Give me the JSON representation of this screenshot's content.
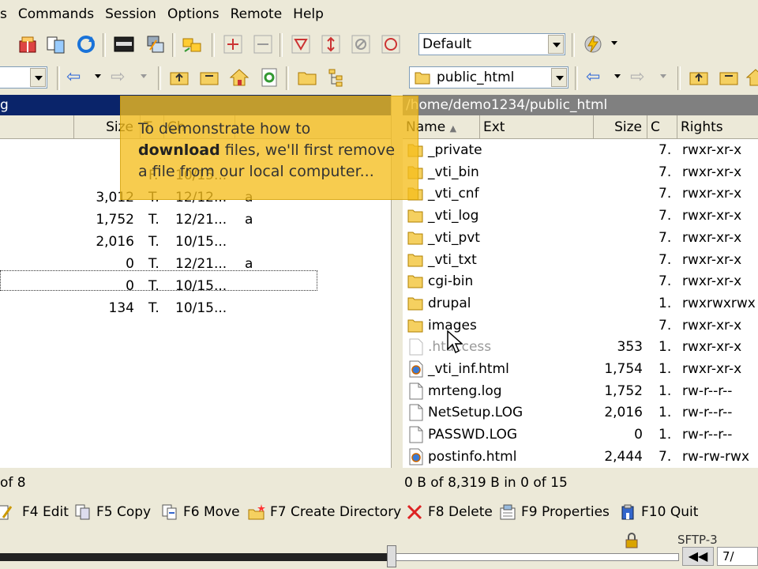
{
  "menu": [
    "s",
    "Commands",
    "Session",
    "Options",
    "Remote",
    "Help"
  ],
  "toolbar": {
    "transfer_settings": "Default"
  },
  "left": {
    "path_combo": "",
    "path": "g",
    "headers": {
      "size": "Size",
      "type": "T.",
      "changed": "Ch"
    },
    "rows": [
      {
        "size": "",
        "type": "F.",
        "changed": "10/15..."
      },
      {
        "size": "3,012",
        "type": "T.",
        "changed": "12/12...",
        "attr": "a"
      },
      {
        "size": "1,752",
        "type": "T.",
        "changed": "12/21...",
        "attr": "a"
      },
      {
        "size": "2,016",
        "type": "T.",
        "changed": "10/15...",
        "attr": ""
      },
      {
        "size": "0",
        "type": "T.",
        "changed": "12/21...",
        "attr": "a"
      },
      {
        "size": "0",
        "type": "T.",
        "changed": "10/15...",
        "attr": ""
      },
      {
        "size": "134",
        "type": "T.",
        "changed": "10/15...",
        "attr": ""
      }
    ],
    "status": "of 8"
  },
  "right": {
    "path_combo": "public_html",
    "path": "/home/demo1234/public_html",
    "headers": {
      "name": "Name",
      "ext": "Ext",
      "size": "Size",
      "changed": "C",
      "rights": "Rights"
    },
    "rows": [
      {
        "name": "_private",
        "size": "",
        "changed": "7.",
        "rights": "rwxr-xr-x",
        "kind": "folder"
      },
      {
        "name": "_vti_bin",
        "size": "",
        "changed": "7.",
        "rights": "rwxr-xr-x",
        "kind": "folder"
      },
      {
        "name": "_vti_cnf",
        "size": "",
        "changed": "7.",
        "rights": "rwxr-xr-x",
        "kind": "folder"
      },
      {
        "name": "_vti_log",
        "size": "",
        "changed": "7.",
        "rights": "rwxr-xr-x",
        "kind": "folder"
      },
      {
        "name": "_vti_pvt",
        "size": "",
        "changed": "7.",
        "rights": "rwxr-xr-x",
        "kind": "folder"
      },
      {
        "name": "_vti_txt",
        "size": "",
        "changed": "7.",
        "rights": "rwxr-xr-x",
        "kind": "folder"
      },
      {
        "name": "cgi-bin",
        "size": "",
        "changed": "7.",
        "rights": "rwxr-xr-x",
        "kind": "folder"
      },
      {
        "name": "drupal",
        "size": "",
        "changed": "1.",
        "rights": "rwxrwxrwx",
        "kind": "folder"
      },
      {
        "name": "images",
        "size": "",
        "changed": "7.",
        "rights": "rwxr-xr-x",
        "kind": "folder"
      },
      {
        "name": ".htaccess",
        "size": "353",
        "changed": "1.",
        "rights": "rwxr-xr-x",
        "kind": "hidden"
      },
      {
        "name": "_vti_inf.html",
        "size": "1,754",
        "changed": "1.",
        "rights": "rwxr-xr-x",
        "kind": "html"
      },
      {
        "name": "mrteng.log",
        "size": "1,752",
        "changed": "1.",
        "rights": "rw-r--r--",
        "kind": "file"
      },
      {
        "name": "NetSetup.LOG",
        "size": "2,016",
        "changed": "1.",
        "rights": "rw-r--r--",
        "kind": "file"
      },
      {
        "name": "PASSWD.LOG",
        "size": "0",
        "changed": "1.",
        "rights": "rw-r--r--",
        "kind": "file"
      },
      {
        "name": "postinfo.html",
        "size": "2,444",
        "changed": "7.",
        "rights": "rw-rw-rwx",
        "kind": "html"
      }
    ],
    "status": "0 B of 8,319 B in 0 of 15"
  },
  "keys": [
    "F4 Edit",
    "F5 Copy",
    "F6 Move",
    "F7 Create Directory",
    "F8 Delete",
    "F9 Properties",
    "F10 Quit"
  ],
  "tooltip": {
    "line1": "To demonstrate how to",
    "bold": "download",
    "line2": " files, we'll first remove",
    "line3": "a file from our local computer..."
  },
  "bottom": {
    "sftp": "SFTP-3",
    "page": "7/"
  }
}
